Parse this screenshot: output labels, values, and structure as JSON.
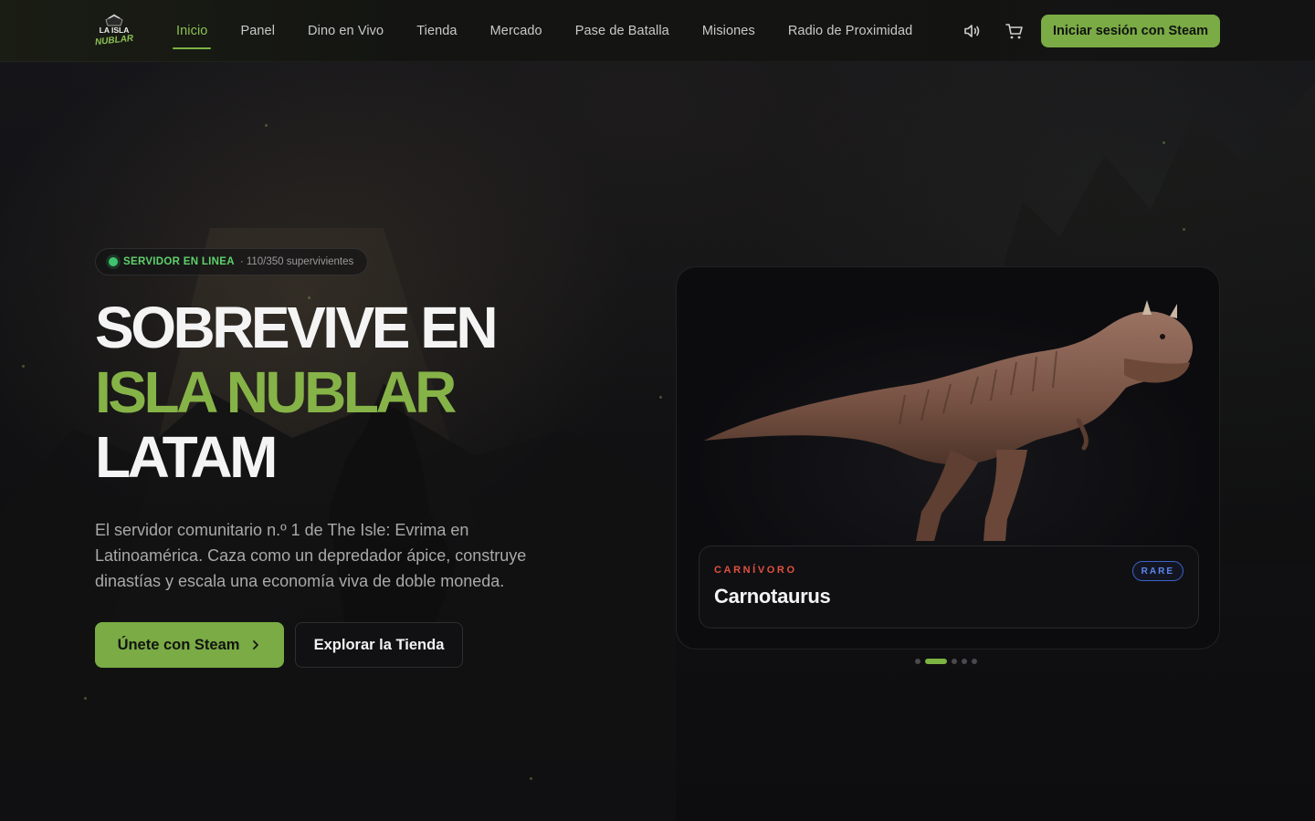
{
  "brand": {
    "logo_alt": "La Isla Nublar",
    "logo_line1": "LA ISLA",
    "logo_line2": "NUBLAR"
  },
  "nav": {
    "items": [
      {
        "label": "Inicio",
        "active": true
      },
      {
        "label": "Panel"
      },
      {
        "label": "Dino en Vivo"
      },
      {
        "label": "Tienda"
      },
      {
        "label": "Mercado"
      },
      {
        "label": "Pase de Batalla"
      },
      {
        "label": "Misiones"
      },
      {
        "label": "Radio de Proximidad"
      }
    ],
    "sound_icon": "speaker-icon",
    "cart_icon": "cart-icon",
    "login_label": "Iniciar sesión con Steam"
  },
  "hero": {
    "status_label": "SERVIDOR EN LINEA",
    "status_count": "· 110/350 supervivientes",
    "headline_1": "SOBREVIVE EN",
    "headline_2": "ISLA NUBLAR",
    "headline_3": "LATAM",
    "lead": "El servidor comunitario n.º 1 de The Isle: Evrima en Latinoamérica. Caza como un depredador ápice, construye dinastías y escala una economía viva de doble moneda.",
    "join_label": "Únete con Steam",
    "shop_label": "Explorar la Tienda"
  },
  "featured": {
    "diet": "CARNÍVORO",
    "name": "Carnotaurus",
    "rarity": "RARE",
    "slides_total": 5,
    "active_slide": 2
  },
  "colors": {
    "accent": "#7aab45",
    "headline_green": "#86b347",
    "online": "#3ec46d",
    "carnivore": "#e2513f",
    "rare": "#3b63c9"
  }
}
